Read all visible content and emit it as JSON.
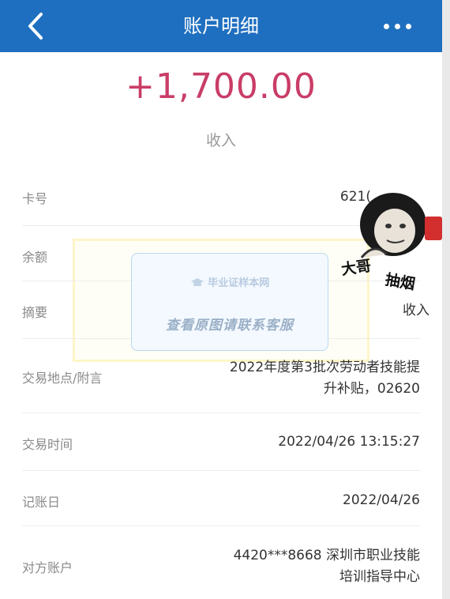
{
  "header": {
    "title": "账户明细",
    "back_icon": "chevron-left-icon",
    "more_icon": "more-dots-icon",
    "color": "#1f6fc0"
  },
  "summary": {
    "amount": "+1,700.00",
    "amount_color": "#c93d67",
    "type": "收入"
  },
  "details": [
    {
      "label": "卡号",
      "value": "621("
    },
    {
      "label": "余额",
      "value": ""
    },
    {
      "label": "摘要",
      "value": "收入"
    },
    {
      "label": "交易地点/附言",
      "value_line1": "2022年度第3批次劳动者技能提",
      "value_line2": "升补贴，02620"
    },
    {
      "label": "交易时间",
      "value": "2022/04/26 13:15:27"
    },
    {
      "label": "记账日",
      "value": "2022/04/26"
    },
    {
      "label": "对方账户",
      "value_line1": "4420***8668 深圳市职业技能",
      "value_line2": "培训指导中心"
    }
  ],
  "watermark": {
    "logo_text": "毕业证样本网",
    "notice": "查看原图请联系客服"
  },
  "sticker": {
    "line1": "大哥",
    "line2": "抽烟"
  }
}
